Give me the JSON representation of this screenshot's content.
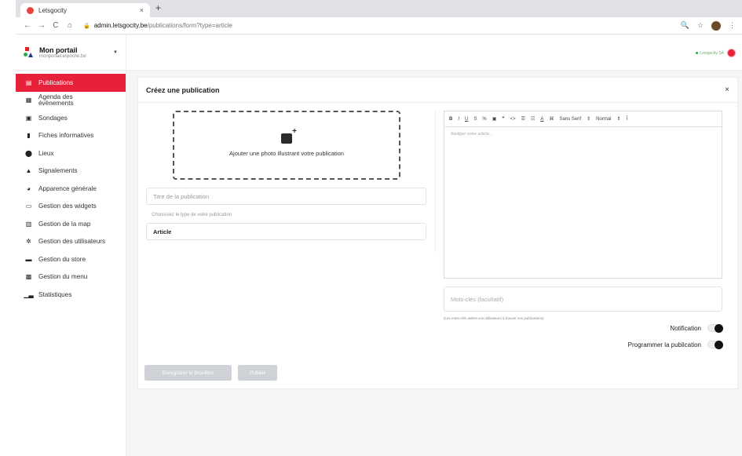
{
  "browser": {
    "tab_title": "Letsgocity",
    "tab_close": "×",
    "new_tab": "+",
    "url_host": "admin.letsgocity.be",
    "url_path": "/publications/form?type=article",
    "back": "←",
    "forward": "→",
    "reload": "C",
    "home": "⌂",
    "zoom_icon": "🔍",
    "star_icon": "☆",
    "menu_icon": "⋮"
  },
  "brand": {
    "name": "Mon portail",
    "sub": "monportail.erpoche.be",
    "caret": "▼"
  },
  "sidebar": {
    "items": [
      {
        "label": "Publications",
        "icon": "▤",
        "active": true
      },
      {
        "label": "Agenda des évènements",
        "icon": "▦"
      },
      {
        "label": "Sondages",
        "icon": "▣"
      },
      {
        "label": "Fiches informatives",
        "icon": "▮"
      },
      {
        "label": "Lieux",
        "icon": "⬤"
      },
      {
        "label": "Signalements",
        "icon": "▲"
      },
      {
        "label": "Apparence générale",
        "icon": "◕"
      },
      {
        "label": "Gestion des widgets",
        "icon": "▭"
      },
      {
        "label": "Gestion de la map",
        "icon": "▥"
      },
      {
        "label": "Gestion des utilisateurs",
        "icon": "✲"
      },
      {
        "label": "Gestion du store",
        "icon": "▬"
      },
      {
        "label": "Gestion du menu",
        "icon": "▩"
      },
      {
        "label": "Statistiques",
        "icon": "▁▃"
      }
    ]
  },
  "topbar": {
    "user_label": "Letsgocity SA"
  },
  "card": {
    "title": "Créez une publication",
    "close": "×",
    "dropzone_text": "Ajouter une photo illustrant votre publication",
    "title_placeholder": "Titre de la publication",
    "type_label": "Choisissez le type de votre publication",
    "type_value": "Article",
    "editor": {
      "toolbar": [
        "B",
        "I",
        "U",
        "S",
        "%",
        "▣",
        "❞",
        "<>",
        "☰",
        "☷",
        "A",
        "⌘",
        "Sans Serif",
        "⇕",
        "Normal",
        "⇕",
        "Ī"
      ],
      "placeholder": "Rédiger votre article..."
    },
    "keywords_placeholder": "Mots-clés (facultatif)",
    "keywords_hint": "(Les mots-clés aident vos utilisateurs à trouver vos publications)",
    "notification_label": "Notification",
    "program_label": "Programmer la publication",
    "draft_button": "Enregistrer le brouillon",
    "publish_button": "Publier"
  }
}
